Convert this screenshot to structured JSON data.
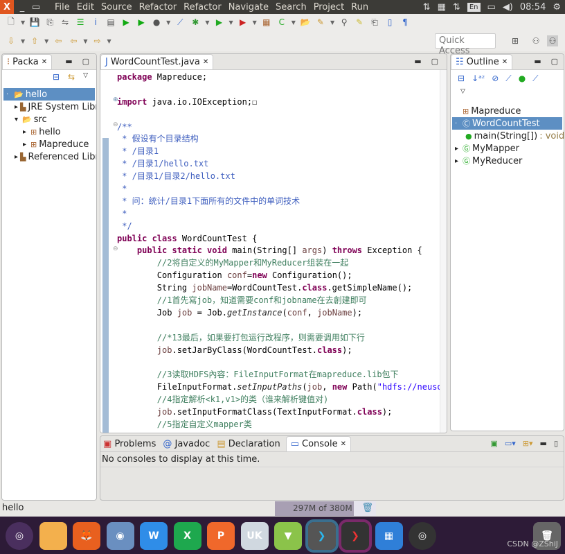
{
  "topbar": {
    "menus": [
      "File",
      "Edit",
      "Source",
      "Refactor",
      "Refactor",
      "Navigate",
      "Search",
      "Project",
      "Run"
    ],
    "lang": "En",
    "time": "08:54"
  },
  "toolbar": {
    "quick_access": "Quick Access"
  },
  "package_explorer": {
    "tab": "Packa",
    "items": [
      {
        "label": "hello",
        "depth": 0,
        "arrow": "·",
        "icon": "project-folder-icon",
        "selected": true
      },
      {
        "label": "JRE System Librar",
        "depth": 1,
        "arrow": "▸",
        "icon": "library-icon"
      },
      {
        "label": "src",
        "depth": 1,
        "arrow": "▾",
        "icon": "source-folder-icon"
      },
      {
        "label": "hello",
        "depth": 2,
        "arrow": "▸",
        "icon": "package-icon"
      },
      {
        "label": "Mapreduce",
        "depth": 2,
        "arrow": "▸",
        "icon": "package-icon"
      },
      {
        "label": "Referenced Librar",
        "depth": 1,
        "arrow": "▸",
        "icon": "library-icon"
      }
    ]
  },
  "editor": {
    "tab": "WordCountTest.java",
    "lines": [
      [
        [
          "package ",
          "kw"
        ],
        [
          "Mapreduce;",
          "plain"
        ]
      ],
      [],
      [
        [
          "import ",
          "kw"
        ],
        [
          "java.io.IOException;",
          "plain"
        ],
        [
          "☐",
          "plain"
        ]
      ],
      [],
      [
        [
          "/**",
          "cm"
        ]
      ],
      [
        [
          " * 假设有个目录结构",
          "cm"
        ]
      ],
      [
        [
          " * /目录1",
          "cm"
        ]
      ],
      [
        [
          " * /目录1/hello.txt",
          "cm"
        ]
      ],
      [
        [
          " * /目录1/目录2/hello.txt",
          "cm"
        ]
      ],
      [
        [
          " *",
          "cm"
        ]
      ],
      [
        [
          " * 问：统计/目录1下面所有的文件中的单词技术",
          "cm"
        ]
      ],
      [
        [
          " *",
          "cm"
        ]
      ],
      [
        [
          " */",
          "cm"
        ]
      ],
      [
        [
          "public class ",
          "kw"
        ],
        [
          "WordCountTest {",
          "plain"
        ]
      ],
      [
        [
          "    public static void ",
          "kw"
        ],
        [
          "main(String[] ",
          "plain"
        ],
        [
          "args",
          "vr"
        ],
        [
          ") ",
          "plain"
        ],
        [
          "throws ",
          "kw"
        ],
        [
          "Exception {",
          "plain"
        ]
      ],
      [
        [
          "        //2将自定义的MyMapper和MyReducer组装在一起",
          "lc"
        ]
      ],
      [
        [
          "        Configuration ",
          "plain"
        ],
        [
          "conf",
          "vr"
        ],
        [
          "=",
          "plain"
        ],
        [
          "new ",
          "kw"
        ],
        [
          "Configuration();",
          "plain"
        ]
      ],
      [
        [
          "        String ",
          "plain"
        ],
        [
          "jobName",
          "vr"
        ],
        [
          "=WordCountTest.",
          "plain"
        ],
        [
          "class",
          "kw"
        ],
        [
          ".getSimpleName();",
          "plain"
        ]
      ],
      [
        [
          "        //1首先寫job，知道需要conf和jobname在去創建即可",
          "lc"
        ]
      ],
      [
        [
          "        Job ",
          "plain"
        ],
        [
          "job",
          "vr"
        ],
        [
          " = Job.",
          "plain"
        ],
        [
          "getInstance",
          "it"
        ],
        [
          "(",
          "plain"
        ],
        [
          "conf",
          "vr"
        ],
        [
          ", ",
          "plain"
        ],
        [
          "jobName",
          "vr"
        ],
        [
          ");",
          "plain"
        ]
      ],
      [],
      [
        [
          "        //*13最后，如果要打包运行改程序，则需要调用如下行",
          "lc"
        ]
      ],
      [
        [
          "        ",
          "plain"
        ],
        [
          "job",
          "vr"
        ],
        [
          ".setJarByClass(WordCountTest.",
          "plain"
        ],
        [
          "class",
          "kw"
        ],
        [
          ");",
          "plain"
        ]
      ],
      [],
      [
        [
          "        //3读取HDFS內容：FileInputFormat在mapreduce.lib包下",
          "lc"
        ]
      ],
      [
        [
          "        FileInputFormat.",
          "plain"
        ],
        [
          "setInputPaths",
          "it"
        ],
        [
          "(",
          "plain"
        ],
        [
          "job",
          "vr"
        ],
        [
          ", ",
          "plain"
        ],
        [
          "new ",
          "kw"
        ],
        [
          "Path(",
          "plain"
        ],
        [
          "\"hdfs://neusoft",
          "st"
        ]
      ],
      [
        [
          "        //4指定解析<k1,v1>的类（谁来解析键值对)",
          "lc"
        ]
      ],
      [
        [
          "        ",
          "plain"
        ],
        [
          "job",
          "vr"
        ],
        [
          ".setInputFormatClass(TextInputFormat.",
          "plain"
        ],
        [
          "class",
          "kw"
        ],
        [
          ");",
          "plain"
        ]
      ],
      [
        [
          "        //5指定自定义mapper类",
          "lc"
        ]
      ]
    ]
  },
  "outline": {
    "tab": "Outline",
    "items": [
      {
        "label": "Mapreduce",
        "depth": 0,
        "arrow": "",
        "icon": "package-icon"
      },
      {
        "label": "WordCountTest",
        "depth": 0,
        "arrow": "·",
        "icon": "class-icon",
        "selected": true
      },
      {
        "label": "main(String[])",
        "suffix": " : void",
        "depth": 1,
        "arrow": "",
        "icon": "method-icon"
      },
      {
        "label": "MyMapper",
        "depth": 0,
        "arrow": "▸",
        "icon": "inner-class-icon"
      },
      {
        "label": "MyReducer",
        "depth": 0,
        "arrow": "▸",
        "icon": "inner-class-icon"
      }
    ]
  },
  "bottom": {
    "tabs": [
      "Problems",
      "Javadoc",
      "Declaration",
      "Console"
    ],
    "active": "Console",
    "message": "No consoles to display at this time."
  },
  "status": {
    "left": "hello",
    "heap": "297M of 380M",
    "heap_used_fraction": 0.78
  },
  "dock": {
    "items": [
      "ubuntu-icon",
      "files-icon",
      "firefox-icon",
      "chromium-icon",
      "wps-writer-icon",
      "wps-spreadsheet-icon",
      "wps-presentation-icon",
      "uk-software-center-icon",
      "store-icon",
      "eclipse-icon",
      "terminal-icon",
      "app-grid-icon",
      "media-player-icon",
      "trash-icon"
    ]
  },
  "watermark": "CSDN @ZShiJ",
  "colors": {
    "selection": "#5d8fc3",
    "dock": "#2d1b37",
    "topbar": "#3c3b37"
  }
}
